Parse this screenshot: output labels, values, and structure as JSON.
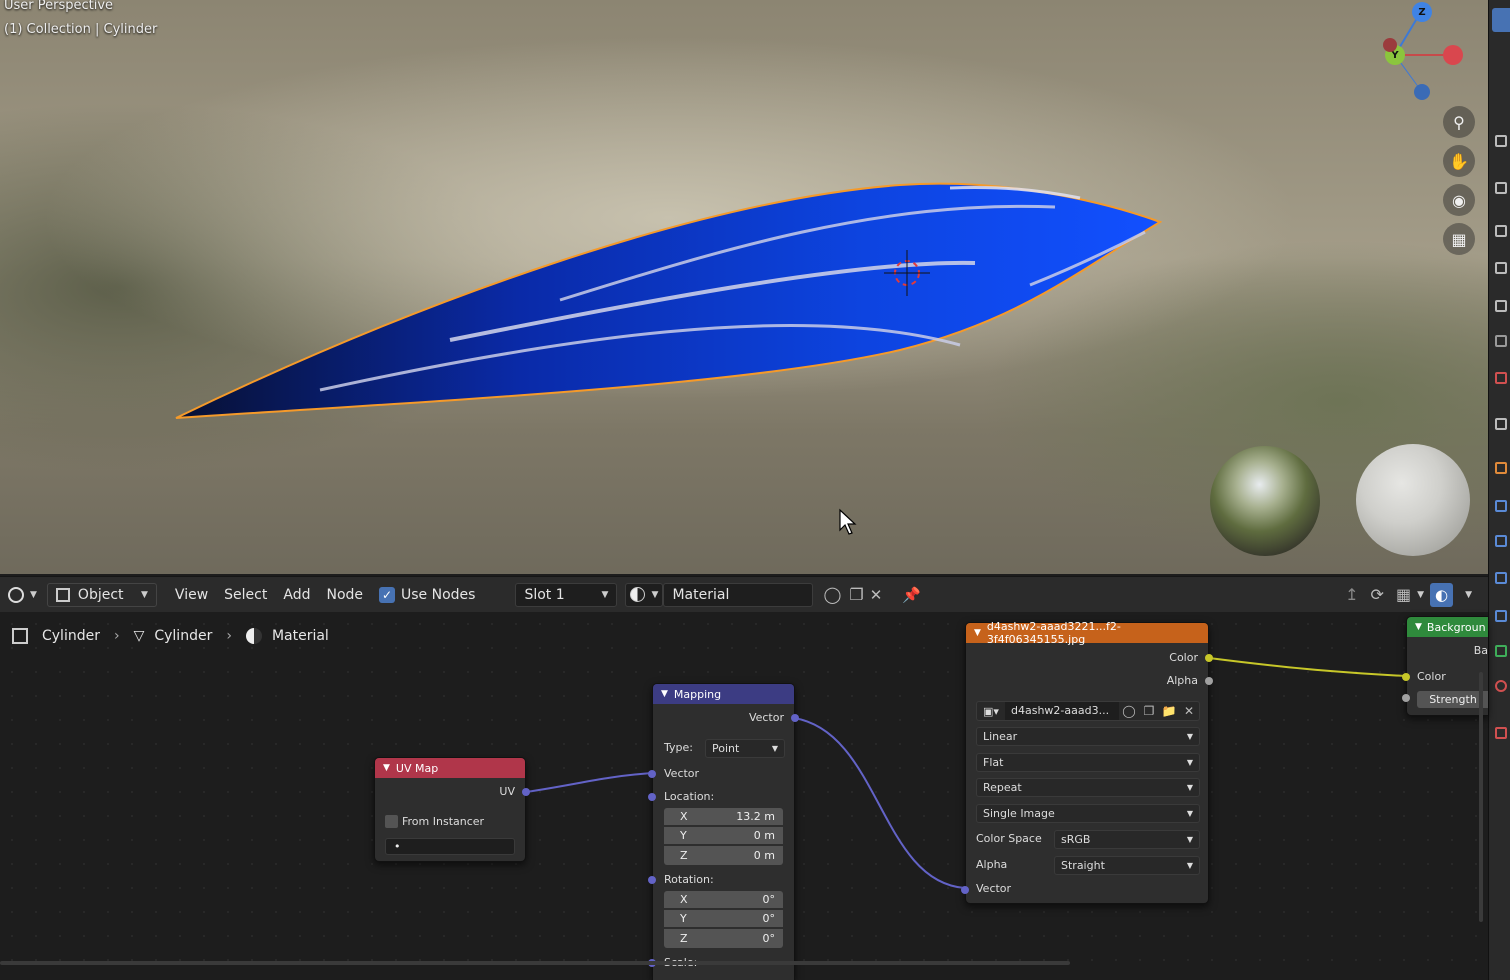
{
  "viewport": {
    "perspective_label": "User Perspective",
    "collection_label": "(1) Collection | Cylinder",
    "gizmo": {
      "z_label": "Z",
      "y_label": "Y"
    }
  },
  "header": {
    "editor_type_icon": "node-editor-icon",
    "mode": "Object",
    "menus": [
      "View",
      "Select",
      "Add",
      "Node"
    ],
    "use_nodes_label": "Use Nodes",
    "use_nodes_checked": true,
    "slot": "Slot 1",
    "material_name": "Material"
  },
  "breadcrumb": [
    "Cylinder",
    "Cylinder",
    "Material"
  ],
  "nodes": {
    "uvmap": {
      "title": "UV Map",
      "output": "UV",
      "from_instancer": "From Instancer",
      "value": "•"
    },
    "mapping": {
      "title": "Mapping",
      "output": "Vector",
      "type_label": "Type:",
      "type_value": "Point",
      "vector_input": "Vector",
      "location_label": "Location:",
      "location": [
        {
          "axis": "X",
          "value": "13.2 m"
        },
        {
          "axis": "Y",
          "value": "0 m"
        },
        {
          "axis": "Z",
          "value": "0 m"
        }
      ],
      "rotation_label": "Rotation:",
      "rotation": [
        {
          "axis": "X",
          "value": "0°"
        },
        {
          "axis": "Y",
          "value": "0°"
        },
        {
          "axis": "Z",
          "value": "0°"
        }
      ],
      "scale_label": "Scale:"
    },
    "image": {
      "title": "d4ashw2-aaad3221...f2-3f4f06345155.jpg",
      "out_color": "Color",
      "out_alpha": "Alpha",
      "image_name": "d4ashw2-aaad3...",
      "interpolation": "Linear",
      "projection": "Flat",
      "extension": "Repeat",
      "source": "Single Image",
      "color_space_label": "Color Space",
      "color_space": "sRGB",
      "alpha_label": "Alpha",
      "alpha_mode": "Straight",
      "vector_input": "Vector"
    },
    "background": {
      "title": "Backgroun",
      "cut_label": "Ba",
      "color_input": "Color",
      "strength": "Strength"
    }
  },
  "colors": {
    "uvmap_header": "#b0364a",
    "mapping_header": "#3c3c83",
    "image_header": "#c6621b",
    "background_header": "#2f8a3c",
    "vector_socket": "#6363c7",
    "color_socket": "#c7c729",
    "accent": "#4772b3"
  }
}
